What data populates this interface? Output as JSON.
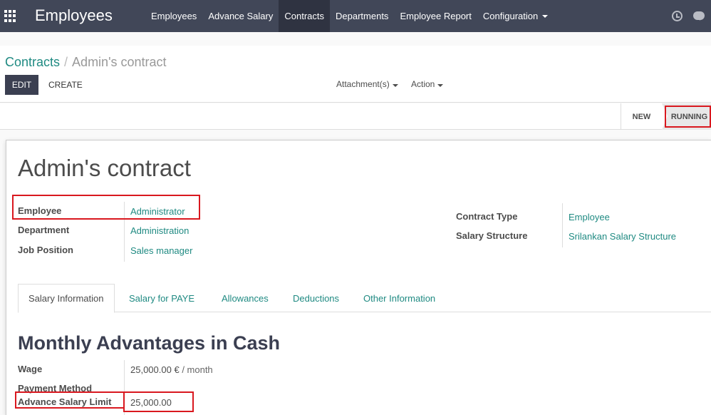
{
  "navbar": {
    "app_title": "Employees",
    "menu": [
      {
        "label": "Employees"
      },
      {
        "label": "Advance Salary"
      },
      {
        "label": "Contracts"
      },
      {
        "label": "Departments"
      },
      {
        "label": "Employee Report"
      },
      {
        "label": "Configuration"
      }
    ],
    "active_menu": "Contracts",
    "icons": [
      "apps-grid-icon",
      "clock-icon",
      "chat-icon"
    ]
  },
  "breadcrumb": {
    "parent": "Contracts",
    "separator": "/",
    "current": "Admin's contract"
  },
  "toolbar": {
    "edit_label": "EDIT",
    "create_label": "CREATE",
    "attachments_label": "Attachment(s)",
    "action_label": "Action"
  },
  "status": {
    "stages": [
      "NEW",
      "RUNNING"
    ],
    "current": "RUNNING"
  },
  "record": {
    "title": "Admin's contract",
    "left_fields": [
      {
        "label": "Employee",
        "value": "Administrator"
      },
      {
        "label": "Department",
        "value": "Administration"
      },
      {
        "label": "Job Position",
        "value": "Sales manager"
      }
    ],
    "right_fields": [
      {
        "label": "Contract Type",
        "value": "Employee"
      },
      {
        "label": "Salary Structure",
        "value": "Srilankan Salary Structure"
      }
    ]
  },
  "tabs": [
    {
      "label": "Salary Information"
    },
    {
      "label": "Salary for PAYE"
    },
    {
      "label": "Allowances"
    },
    {
      "label": "Deductions"
    },
    {
      "label": "Other Information"
    }
  ],
  "active_tab": "Salary Information",
  "salary_section": {
    "title": "Monthly Advantages in Cash",
    "wage_label": "Wage",
    "wage_value": "25,000.00 €",
    "wage_unit": "/ month",
    "payment_method_label": "Payment Method",
    "payment_method_value": "",
    "advance_limit_label": "Advance Salary Limit",
    "advance_limit_value": "25,000.00"
  },
  "colors": {
    "navbar_bg": "#414758",
    "navbar_active": "#2f3341",
    "link": "#1f8a82",
    "highlight_border": "#d9181f",
    "edit_button_bg": "#3b3f51"
  }
}
